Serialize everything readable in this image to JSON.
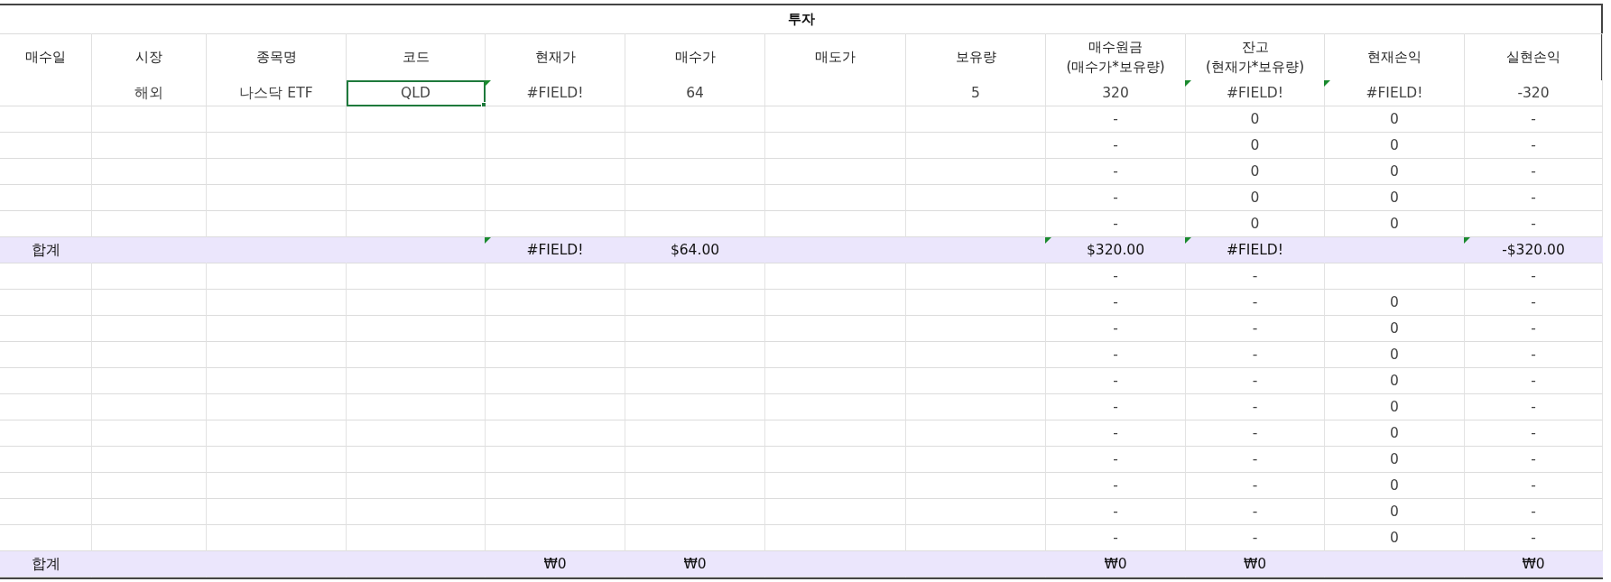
{
  "sheet": {
    "title": "투자",
    "columns": [
      "매수일",
      "시장",
      "종목명",
      "코드",
      "현재가",
      "매수가",
      "매도가",
      "보유량",
      "매수원금\n(매수가*보유량)",
      "잔고\n(현재가*보유량)",
      "현재손익",
      "실현손익"
    ],
    "rows": [
      {
        "kind": "data",
        "cells": [
          {
            "selected": false,
            "flag": false
          },
          {
            "text": "해외",
            "selected": false,
            "flag": false
          },
          {
            "text": "나스닥 ETF",
            "selected": false,
            "flag": false
          },
          {
            "text": "QLD",
            "selected": true,
            "flag": false
          },
          {
            "text": "#FIELD!",
            "selected": false,
            "flag": true
          },
          {
            "text": "64",
            "selected": false,
            "flag": false
          },
          {
            "selected": false,
            "flag": false
          },
          {
            "text": "5",
            "selected": false,
            "flag": false
          },
          {
            "text": "320",
            "selected": false,
            "flag": false
          },
          {
            "text": "#FIELD!",
            "selected": false,
            "flag": true
          },
          {
            "text": "#FIELD!",
            "selected": false,
            "flag": true
          },
          {
            "text": "-320",
            "selected": false,
            "flag": false
          }
        ]
      },
      {
        "kind": "data",
        "cells": [
          {
            "selected": false,
            "flag": false
          },
          {
            "selected": false,
            "flag": false
          },
          {
            "selected": false,
            "flag": false
          },
          {
            "selected": false,
            "flag": false
          },
          {
            "selected": false,
            "flag": false
          },
          {
            "selected": false,
            "flag": false
          },
          {
            "selected": false,
            "flag": false
          },
          {
            "selected": false,
            "flag": false
          },
          {
            "text": "-",
            "selected": false,
            "flag": false
          },
          {
            "text": "0",
            "selected": false,
            "flag": false
          },
          {
            "text": "0",
            "selected": false,
            "flag": false
          },
          {
            "text": "-",
            "selected": false,
            "flag": false
          }
        ]
      },
      {
        "kind": "data",
        "cells": [
          {
            "selected": false,
            "flag": false
          },
          {
            "selected": false,
            "flag": false
          },
          {
            "selected": false,
            "flag": false
          },
          {
            "selected": false,
            "flag": false
          },
          {
            "selected": false,
            "flag": false
          },
          {
            "selected": false,
            "flag": false
          },
          {
            "selected": false,
            "flag": false
          },
          {
            "selected": false,
            "flag": false
          },
          {
            "text": "-",
            "selected": false,
            "flag": false
          },
          {
            "text": "0",
            "selected": false,
            "flag": false
          },
          {
            "text": "0",
            "selected": false,
            "flag": false
          },
          {
            "text": "-",
            "selected": false,
            "flag": false
          }
        ]
      },
      {
        "kind": "data",
        "cells": [
          {
            "selected": false,
            "flag": false
          },
          {
            "selected": false,
            "flag": false
          },
          {
            "selected": false,
            "flag": false
          },
          {
            "selected": false,
            "flag": false
          },
          {
            "selected": false,
            "flag": false
          },
          {
            "selected": false,
            "flag": false
          },
          {
            "selected": false,
            "flag": false
          },
          {
            "selected": false,
            "flag": false
          },
          {
            "text": "-",
            "selected": false,
            "flag": false
          },
          {
            "text": "0",
            "selected": false,
            "flag": false
          },
          {
            "text": "0",
            "selected": false,
            "flag": false
          },
          {
            "text": "-",
            "selected": false,
            "flag": false
          }
        ]
      },
      {
        "kind": "data",
        "cells": [
          {
            "selected": false,
            "flag": false
          },
          {
            "selected": false,
            "flag": false
          },
          {
            "selected": false,
            "flag": false
          },
          {
            "selected": false,
            "flag": false
          },
          {
            "selected": false,
            "flag": false
          },
          {
            "selected": false,
            "flag": false
          },
          {
            "selected": false,
            "flag": false
          },
          {
            "selected": false,
            "flag": false
          },
          {
            "text": "-",
            "selected": false,
            "flag": false
          },
          {
            "text": "0",
            "selected": false,
            "flag": false
          },
          {
            "text": "0",
            "selected": false,
            "flag": false
          },
          {
            "text": "-",
            "selected": false,
            "flag": false
          }
        ]
      },
      {
        "kind": "data",
        "cells": [
          {
            "selected": false,
            "flag": false
          },
          {
            "selected": false,
            "flag": false
          },
          {
            "selected": false,
            "flag": false
          },
          {
            "selected": false,
            "flag": false
          },
          {
            "selected": false,
            "flag": false
          },
          {
            "selected": false,
            "flag": false
          },
          {
            "selected": false,
            "flag": false
          },
          {
            "selected": false,
            "flag": false
          },
          {
            "text": "-",
            "selected": false,
            "flag": false
          },
          {
            "text": "0",
            "selected": false,
            "flag": false
          },
          {
            "text": "0",
            "selected": false,
            "flag": false
          },
          {
            "text": "-",
            "selected": false,
            "flag": false
          }
        ]
      },
      {
        "kind": "total",
        "cells": [
          {
            "text": "합계",
            "selected": false,
            "flag": false
          },
          {
            "selected": false,
            "flag": false
          },
          {
            "selected": false,
            "flag": false
          },
          {
            "selected": false,
            "flag": false
          },
          {
            "text": "#FIELD!",
            "selected": false,
            "flag": true
          },
          {
            "text": "$64.00",
            "selected": false,
            "flag": false
          },
          {
            "selected": false,
            "flag": false
          },
          {
            "selected": false,
            "flag": false
          },
          {
            "text": "$320.00",
            "selected": false,
            "flag": true
          },
          {
            "text": "#FIELD!",
            "selected": false,
            "flag": true
          },
          {
            "selected": false,
            "flag": false
          },
          {
            "text": "-$320.00",
            "selected": false,
            "flag": true
          }
        ]
      },
      {
        "kind": "data",
        "cells": [
          {
            "selected": false,
            "flag": false
          },
          {
            "selected": false,
            "flag": false
          },
          {
            "selected": false,
            "flag": false
          },
          {
            "selected": false,
            "flag": false
          },
          {
            "selected": false,
            "flag": false
          },
          {
            "selected": false,
            "flag": false
          },
          {
            "selected": false,
            "flag": false
          },
          {
            "selected": false,
            "flag": false
          },
          {
            "text": "-",
            "selected": false,
            "flag": false
          },
          {
            "text": "-",
            "selected": false,
            "flag": false
          },
          {
            "selected": false,
            "flag": false
          },
          {
            "text": "-",
            "selected": false,
            "flag": false
          }
        ]
      },
      {
        "kind": "data",
        "cells": [
          {
            "selected": false,
            "flag": false
          },
          {
            "selected": false,
            "flag": false
          },
          {
            "selected": false,
            "flag": false
          },
          {
            "selected": false,
            "flag": false
          },
          {
            "selected": false,
            "flag": false
          },
          {
            "selected": false,
            "flag": false
          },
          {
            "selected": false,
            "flag": false
          },
          {
            "selected": false,
            "flag": false
          },
          {
            "text": "-",
            "selected": false,
            "flag": false
          },
          {
            "text": "-",
            "selected": false,
            "flag": false
          },
          {
            "text": "0",
            "selected": false,
            "flag": false
          },
          {
            "text": "-",
            "selected": false,
            "flag": false
          }
        ]
      },
      {
        "kind": "data",
        "cells": [
          {
            "selected": false,
            "flag": false
          },
          {
            "selected": false,
            "flag": false
          },
          {
            "selected": false,
            "flag": false
          },
          {
            "selected": false,
            "flag": false
          },
          {
            "selected": false,
            "flag": false
          },
          {
            "selected": false,
            "flag": false
          },
          {
            "selected": false,
            "flag": false
          },
          {
            "selected": false,
            "flag": false
          },
          {
            "text": "-",
            "selected": false,
            "flag": false
          },
          {
            "text": "-",
            "selected": false,
            "flag": false
          },
          {
            "text": "0",
            "selected": false,
            "flag": false
          },
          {
            "text": "-",
            "selected": false,
            "flag": false
          }
        ]
      },
      {
        "kind": "data",
        "cells": [
          {
            "selected": false,
            "flag": false
          },
          {
            "selected": false,
            "flag": false
          },
          {
            "selected": false,
            "flag": false
          },
          {
            "selected": false,
            "flag": false
          },
          {
            "selected": false,
            "flag": false
          },
          {
            "selected": false,
            "flag": false
          },
          {
            "selected": false,
            "flag": false
          },
          {
            "selected": false,
            "flag": false
          },
          {
            "text": "-",
            "selected": false,
            "flag": false
          },
          {
            "text": "-",
            "selected": false,
            "flag": false
          },
          {
            "text": "0",
            "selected": false,
            "flag": false
          },
          {
            "text": "-",
            "selected": false,
            "flag": false
          }
        ]
      },
      {
        "kind": "data",
        "cells": [
          {
            "selected": false,
            "flag": false
          },
          {
            "selected": false,
            "flag": false
          },
          {
            "selected": false,
            "flag": false
          },
          {
            "selected": false,
            "flag": false
          },
          {
            "selected": false,
            "flag": false
          },
          {
            "selected": false,
            "flag": false
          },
          {
            "selected": false,
            "flag": false
          },
          {
            "selected": false,
            "flag": false
          },
          {
            "text": "-",
            "selected": false,
            "flag": false
          },
          {
            "text": "-",
            "selected": false,
            "flag": false
          },
          {
            "text": "0",
            "selected": false,
            "flag": false
          },
          {
            "text": "-",
            "selected": false,
            "flag": false
          }
        ]
      },
      {
        "kind": "data",
        "cells": [
          {
            "selected": false,
            "flag": false
          },
          {
            "selected": false,
            "flag": false
          },
          {
            "selected": false,
            "flag": false
          },
          {
            "selected": false,
            "flag": false
          },
          {
            "selected": false,
            "flag": false
          },
          {
            "selected": false,
            "flag": false
          },
          {
            "selected": false,
            "flag": false
          },
          {
            "selected": false,
            "flag": false
          },
          {
            "text": "-",
            "selected": false,
            "flag": false
          },
          {
            "text": "-",
            "selected": false,
            "flag": false
          },
          {
            "text": "0",
            "selected": false,
            "flag": false
          },
          {
            "text": "-",
            "selected": false,
            "flag": false
          }
        ]
      },
      {
        "kind": "data",
        "cells": [
          {
            "selected": false,
            "flag": false
          },
          {
            "selected": false,
            "flag": false
          },
          {
            "selected": false,
            "flag": false
          },
          {
            "selected": false,
            "flag": false
          },
          {
            "selected": false,
            "flag": false
          },
          {
            "selected": false,
            "flag": false
          },
          {
            "selected": false,
            "flag": false
          },
          {
            "selected": false,
            "flag": false
          },
          {
            "text": "-",
            "selected": false,
            "flag": false
          },
          {
            "text": "-",
            "selected": false,
            "flag": false
          },
          {
            "text": "0",
            "selected": false,
            "flag": false
          },
          {
            "text": "-",
            "selected": false,
            "flag": false
          }
        ]
      },
      {
        "kind": "data",
        "cells": [
          {
            "selected": false,
            "flag": false
          },
          {
            "selected": false,
            "flag": false
          },
          {
            "selected": false,
            "flag": false
          },
          {
            "selected": false,
            "flag": false
          },
          {
            "selected": false,
            "flag": false
          },
          {
            "selected": false,
            "flag": false
          },
          {
            "selected": false,
            "flag": false
          },
          {
            "selected": false,
            "flag": false
          },
          {
            "text": "-",
            "selected": false,
            "flag": false
          },
          {
            "text": "-",
            "selected": false,
            "flag": false
          },
          {
            "text": "0",
            "selected": false,
            "flag": false
          },
          {
            "text": "-",
            "selected": false,
            "flag": false
          }
        ]
      },
      {
        "kind": "data",
        "cells": [
          {
            "selected": false,
            "flag": false
          },
          {
            "selected": false,
            "flag": false
          },
          {
            "selected": false,
            "flag": false
          },
          {
            "selected": false,
            "flag": false
          },
          {
            "selected": false,
            "flag": false
          },
          {
            "selected": false,
            "flag": false
          },
          {
            "selected": false,
            "flag": false
          },
          {
            "selected": false,
            "flag": false
          },
          {
            "text": "-",
            "selected": false,
            "flag": false
          },
          {
            "text": "-",
            "selected": false,
            "flag": false
          },
          {
            "text": "0",
            "selected": false,
            "flag": false
          },
          {
            "text": "-",
            "selected": false,
            "flag": false
          }
        ]
      },
      {
        "kind": "data",
        "cells": [
          {
            "selected": false,
            "flag": false
          },
          {
            "selected": false,
            "flag": false
          },
          {
            "selected": false,
            "flag": false
          },
          {
            "selected": false,
            "flag": false
          },
          {
            "selected": false,
            "flag": false
          },
          {
            "selected": false,
            "flag": false
          },
          {
            "selected": false,
            "flag": false
          },
          {
            "selected": false,
            "flag": false
          },
          {
            "text": "-",
            "selected": false,
            "flag": false
          },
          {
            "text": "-",
            "selected": false,
            "flag": false
          },
          {
            "text": "0",
            "selected": false,
            "flag": false
          },
          {
            "text": "-",
            "selected": false,
            "flag": false
          }
        ]
      },
      {
        "kind": "data",
        "cells": [
          {
            "selected": false,
            "flag": false
          },
          {
            "selected": false,
            "flag": false
          },
          {
            "selected": false,
            "flag": false
          },
          {
            "selected": false,
            "flag": false
          },
          {
            "selected": false,
            "flag": false
          },
          {
            "selected": false,
            "flag": false
          },
          {
            "selected": false,
            "flag": false
          },
          {
            "selected": false,
            "flag": false
          },
          {
            "text": "-",
            "selected": false,
            "flag": false
          },
          {
            "text": "-",
            "selected": false,
            "flag": false
          },
          {
            "text": "0",
            "selected": false,
            "flag": false
          },
          {
            "text": "-",
            "selected": false,
            "flag": false
          }
        ]
      },
      {
        "kind": "total",
        "cells": [
          {
            "text": "합계",
            "selected": false,
            "flag": false
          },
          {
            "selected": false,
            "flag": false
          },
          {
            "selected": false,
            "flag": false
          },
          {
            "selected": false,
            "flag": false
          },
          {
            "text": "₩0",
            "selected": false,
            "flag": false
          },
          {
            "text": "₩0",
            "selected": false,
            "flag": false
          },
          {
            "selected": false,
            "flag": false
          },
          {
            "selected": false,
            "flag": false
          },
          {
            "text": "₩0",
            "selected": false,
            "flag": false
          },
          {
            "text": "₩0",
            "selected": false,
            "flag": false
          },
          {
            "selected": false,
            "flag": false
          },
          {
            "text": "₩0",
            "selected": false,
            "flag": false
          }
        ]
      }
    ]
  }
}
